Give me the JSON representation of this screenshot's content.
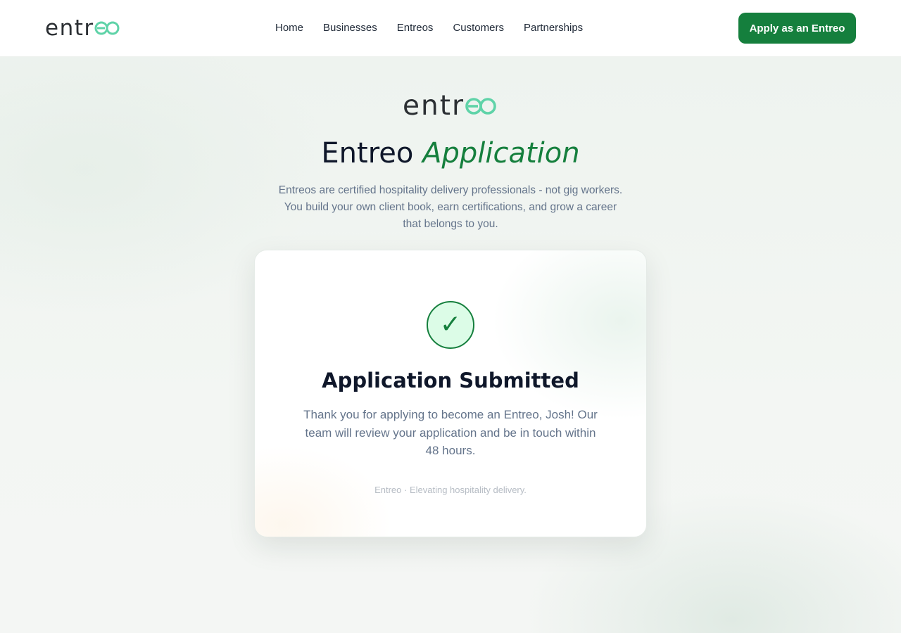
{
  "header": {
    "logo": {
      "text_main": "entr",
      "text_mark": "eo"
    },
    "nav": [
      {
        "label": "Home"
      },
      {
        "label": "Businesses"
      },
      {
        "label": "Entreos"
      },
      {
        "label": "Customers"
      },
      {
        "label": "Partnerships"
      }
    ],
    "cta_label": "Apply as an Entreo"
  },
  "hero": {
    "logo": {
      "text_main": "entr",
      "text_mark": "eo"
    },
    "title_plain": "Entreo",
    "title_accent": "Application",
    "intro": "Entreos are certified hospitality delivery professionals - not gig workers. You build your own client book, earn certifications, and grow a career that belongs to you."
  },
  "confirmation": {
    "icon": "check-icon",
    "check_glyph": "✓",
    "title": "Application Submitted",
    "message": "Thank you for applying to become an Entreo, Josh! Our team will review your application and be in touch within 48 hours.",
    "footer": "Entreo · Elevating hospitality delivery."
  },
  "colors": {
    "brand_green": "#157f3d",
    "logo_mint": "#5fd3a8",
    "logo_dark": "#2b2f33",
    "muted_text": "#64748b",
    "success_bg": "#dcfce7"
  }
}
